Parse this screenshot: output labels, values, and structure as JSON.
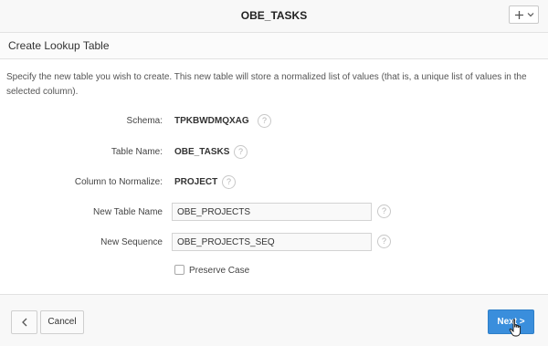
{
  "header": {
    "title": "OBE_TASKS",
    "menu_icon": "plus-chevron-menu"
  },
  "region": {
    "title": "Create Lookup Table"
  },
  "description": "Specify the new table you wish to create. This new table will store a normalized list of values (that is, a unique list of values in the selected column).",
  "form": {
    "schema": {
      "label": "Schema:",
      "value": "TPKBWDMQXAG"
    },
    "table_name": {
      "label": "Table Name:",
      "value": "OBE_TASKS"
    },
    "column": {
      "label": "Column to Normalize:",
      "value": "PROJECT"
    },
    "new_table": {
      "label": "New Table Name",
      "value": "OBE_PROJECTS"
    },
    "new_sequence": {
      "label": "New Sequence",
      "value": "OBE_PROJECTS_SEQ"
    },
    "preserve_case": {
      "label": "Preserve Case",
      "checked": false
    },
    "help_glyph": "?"
  },
  "footer": {
    "back_icon": "chevron-left-icon",
    "cancel_label": "Cancel",
    "next_label": "Next >"
  },
  "colors": {
    "primary_button": "#3a8edc",
    "header_bg": "#f8f8f8"
  }
}
